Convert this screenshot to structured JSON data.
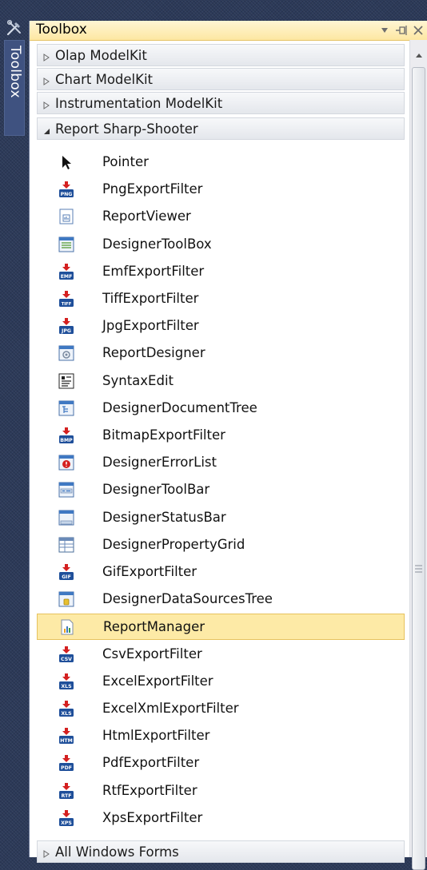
{
  "sidebar": {
    "tab_label": "Toolbox",
    "icon": "toolbox-icon"
  },
  "toolbox": {
    "title": "Toolbox",
    "buttons": [
      "dropdown-icon",
      "pin-icon",
      "close-icon"
    ],
    "categories": {
      "olap": {
        "label": "Olap ModelKit",
        "expanded": false
      },
      "chart": {
        "label": "Chart ModelKit",
        "expanded": false
      },
      "instrumentation": {
        "label": "Instrumentation ModelKit",
        "expanded": false
      },
      "report": {
        "label": "Report Sharp-Shooter",
        "expanded": true
      },
      "winforms": {
        "label": "All Windows Forms",
        "expanded": false
      }
    },
    "items": [
      {
        "label": "Pointer",
        "icon": "pointer-icon"
      },
      {
        "label": "PngExportFilter",
        "icon": "png-export-icon",
        "badge": "PNG"
      },
      {
        "label": "ReportViewer",
        "icon": "report-viewer-icon"
      },
      {
        "label": "DesignerToolBox",
        "icon": "designer-toolbox-icon"
      },
      {
        "label": "EmfExportFilter",
        "icon": "emf-export-icon",
        "badge": "EMF"
      },
      {
        "label": "TiffExportFilter",
        "icon": "tiff-export-icon",
        "badge": "TIFF"
      },
      {
        "label": "JpgExportFilter",
        "icon": "jpg-export-icon",
        "badge": "JPG"
      },
      {
        "label": "ReportDesigner",
        "icon": "report-designer-icon"
      },
      {
        "label": "SyntaxEdit",
        "icon": "syntax-edit-icon"
      },
      {
        "label": "DesignerDocumentTree",
        "icon": "document-tree-icon"
      },
      {
        "label": "BitmapExportFilter",
        "icon": "bmp-export-icon",
        "badge": "BMP"
      },
      {
        "label": "DesignerErrorList",
        "icon": "error-list-icon"
      },
      {
        "label": "DesignerToolBar",
        "icon": "toolbar-icon"
      },
      {
        "label": "DesignerStatusBar",
        "icon": "statusbar-icon"
      },
      {
        "label": "DesignerPropertyGrid",
        "icon": "property-grid-icon"
      },
      {
        "label": "GifExportFilter",
        "icon": "gif-export-icon",
        "badge": "GIF"
      },
      {
        "label": "DesignerDataSourcesTree",
        "icon": "datasources-tree-icon"
      },
      {
        "label": "ReportManager",
        "icon": "report-manager-icon",
        "selected": true
      },
      {
        "label": "CsvExportFilter",
        "icon": "csv-export-icon",
        "badge": "CSV"
      },
      {
        "label": "ExcelExportFilter",
        "icon": "xls-export-icon",
        "badge": "XLS"
      },
      {
        "label": "ExcelXmlExportFilter",
        "icon": "xls-xml-export-icon",
        "badge": "XLS"
      },
      {
        "label": "HtmlExportFilter",
        "icon": "htm-export-icon",
        "badge": "HTM"
      },
      {
        "label": "PdfExportFilter",
        "icon": "pdf-export-icon",
        "badge": "PDF"
      },
      {
        "label": "RtfExportFilter",
        "icon": "rtf-export-icon",
        "badge": "RTF"
      },
      {
        "label": "XpsExportFilter",
        "icon": "xps-export-icon",
        "badge": "XPS"
      }
    ]
  },
  "colors": {
    "title_bar": "#fde7a2",
    "selection": "#fdeaa6",
    "sidebar": "#2c3a59",
    "export_badge": "#1f4f9a",
    "export_arrow": "#d42020"
  }
}
